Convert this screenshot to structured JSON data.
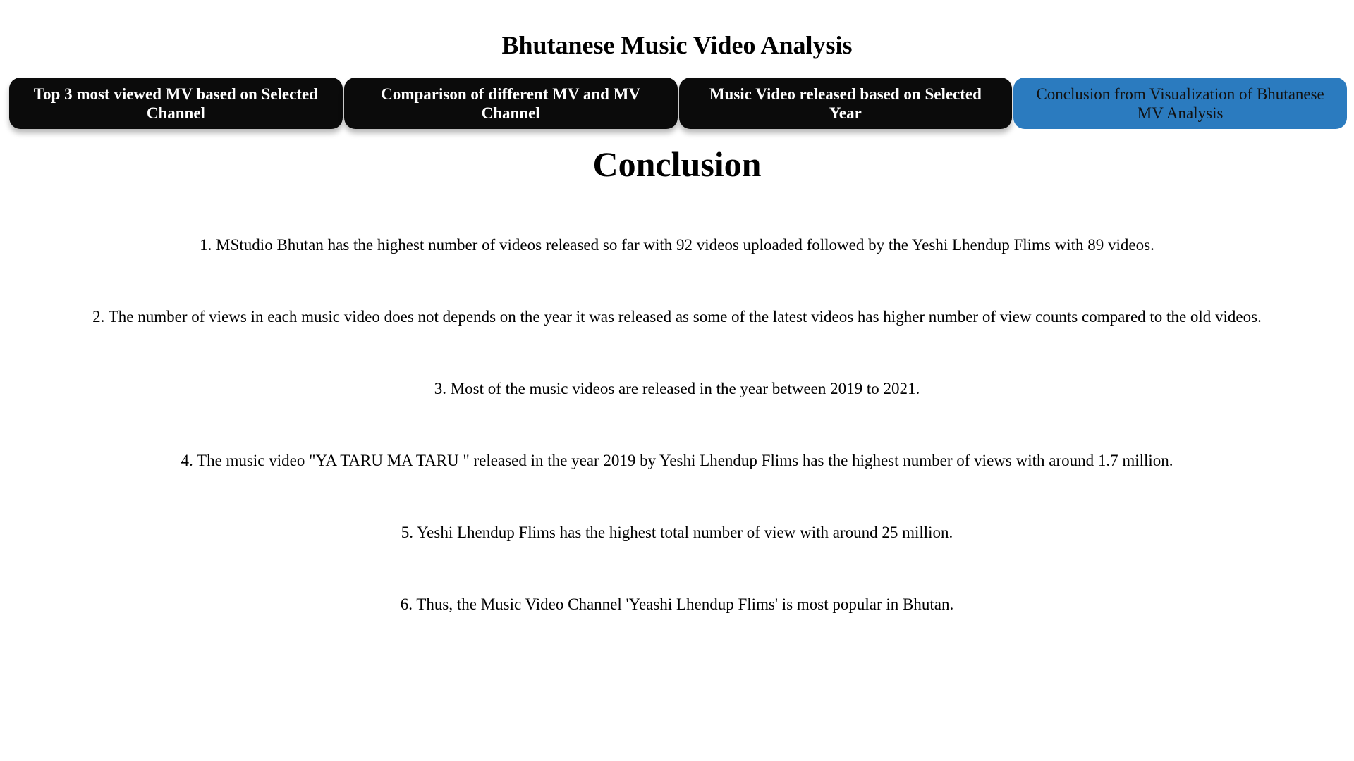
{
  "header": {
    "title": "Bhutanese Music Video Analysis"
  },
  "tabs": [
    {
      "label": "Top 3 most viewed MV based on Selected Channel",
      "active": false
    },
    {
      "label": "Comparison of different MV and MV Channel",
      "active": false
    },
    {
      "label": "Music Video released based on Selected Year",
      "active": false
    },
    {
      "label": "Conclusion from Visualization of Bhutanese MV Analysis",
      "active": true
    }
  ],
  "colors": {
    "tab_background": "#0b0b0b",
    "tab_active_background": "#2b7bbf"
  },
  "main": {
    "heading": "Conclusion",
    "points": [
      "1. MStudio Bhutan has the highest number of videos released so far with 92 videos uploaded followed by the Yeshi Lhendup Flims with 89 videos.",
      "2. The number of views in each music video does not depends on the year it was released as some of the latest videos has higher number of view counts compared to the old videos.",
      "3. Most of the music videos are released in the year between 2019 to 2021.",
      "4. The music video \"YA TARU MA TARU \" released in the year 2019 by Yeshi Lhendup Flims has the highest number of views with around 1.7 million.",
      "5. Yeshi Lhendup Flims has the highest total number of view with around 25 million.",
      "6. Thus, the Music Video Channel 'Yeashi Lhendup Flims' is most popular in Bhutan."
    ]
  }
}
